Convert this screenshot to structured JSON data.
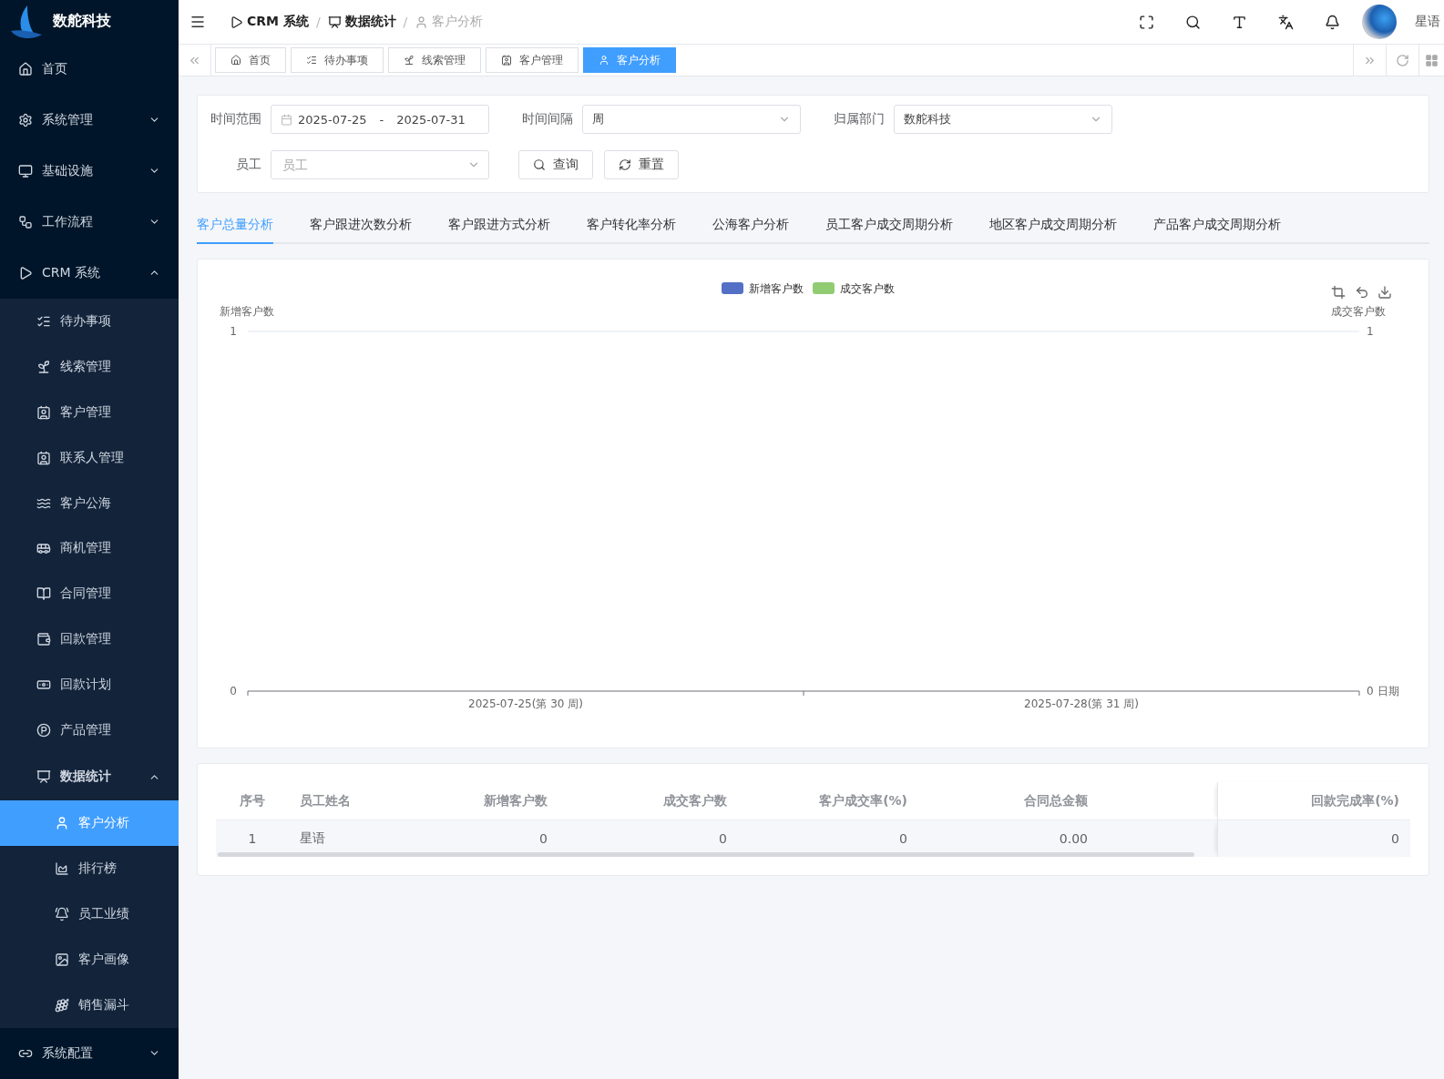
{
  "brand": {
    "name": "数舵科技"
  },
  "sidebar": {
    "items": [
      {
        "label": "首页",
        "selected": false
      },
      {
        "label": "系统管理",
        "expanded": false,
        "selected": false
      },
      {
        "label": "基础设施",
        "expanded": false,
        "selected": false
      },
      {
        "label": "工作流程",
        "expanded": false,
        "selected": false
      },
      {
        "label": "CRM 系统",
        "expanded": true,
        "selected": false,
        "children": [
          {
            "label": "待办事项",
            "selected": false
          },
          {
            "label": "线索管理",
            "selected": false
          },
          {
            "label": "客户管理",
            "selected": false
          },
          {
            "label": "联系人管理",
            "selected": false
          },
          {
            "label": "客户公海",
            "selected": false
          },
          {
            "label": "商机管理",
            "selected": false
          },
          {
            "label": "合同管理",
            "selected": false
          },
          {
            "label": "回款管理",
            "selected": false
          },
          {
            "label": "回款计划",
            "selected": false
          },
          {
            "label": "产品管理",
            "selected": false
          },
          {
            "label": "数据统计",
            "expanded": true,
            "selected": false,
            "children": [
              {
                "label": "客户分析",
                "selected": true
              },
              {
                "label": "排行榜",
                "selected": false
              },
              {
                "label": "员工业绩",
                "selected": false
              },
              {
                "label": "客户画像",
                "selected": false
              },
              {
                "label": "销售漏斗",
                "selected": false
              }
            ]
          }
        ]
      },
      {
        "label": "系统配置",
        "expanded": false,
        "selected": false
      }
    ]
  },
  "header": {
    "breadcrumb": [
      {
        "label": "CRM 系统"
      },
      {
        "separator": "/",
        "label": "数据统计"
      },
      {
        "separator": "/",
        "label": "客户分析"
      }
    ],
    "user": {
      "name": "星语"
    }
  },
  "page_tabs": [
    {
      "label": "首页",
      "selected": false
    },
    {
      "label": "待办事项",
      "selected": false
    },
    {
      "label": "线索管理",
      "selected": false
    },
    {
      "label": "客户管理",
      "selected": false
    },
    {
      "label": "客户分析",
      "selected": true
    }
  ],
  "filters": {
    "time_range": {
      "label": "时间范围",
      "start": "2025-07-25",
      "separator": "-",
      "end": "2025-07-31"
    },
    "interval": {
      "label": "时间间隔",
      "value": "周"
    },
    "department": {
      "label": "归属部门",
      "value": "数舵科技"
    },
    "employee": {
      "label": "员工",
      "placeholder": "员工"
    },
    "buttons": [
      {
        "label": "查询",
        "kind": "search"
      },
      {
        "label": "重置",
        "kind": "reset"
      }
    ]
  },
  "analysis_tabs": [
    {
      "label": "客户总量分析",
      "selected": true
    },
    {
      "label": "客户跟进次数分析",
      "selected": false
    },
    {
      "label": "客户跟进方式分析",
      "selected": false
    },
    {
      "label": "客户转化率分析",
      "selected": false
    },
    {
      "label": "公海客户分析",
      "selected": false
    },
    {
      "label": "员工客户成交周期分析",
      "selected": false
    },
    {
      "label": "地区客户成交周期分析",
      "selected": false
    },
    {
      "label": "产品客户成交周期分析",
      "selected": false
    }
  ],
  "chart_data": {
    "type": "bar",
    "ylabel": "新增客户数",
    "xlabel": "日期",
    "categories": [
      "2025-07-25(第 30 周)",
      "2025-07-28(第 31 周)"
    ],
    "series": [
      {
        "name": "新增客户数",
        "color": "#5470c6",
        "values": [
          0,
          0
        ]
      },
      {
        "name": "成交客户数",
        "color": "#91cc75",
        "values": [
          0,
          0
        ]
      }
    ],
    "ylim": [
      0,
      1
    ],
    "yticks": [
      {
        "value": 0,
        "label": "0"
      },
      {
        "value": 1,
        "label": "1"
      }
    ]
  },
  "chart_right_axis": {
    "title": "成交客户数",
    "ticks": [
      "1",
      "0"
    ]
  },
  "table": {
    "columns": [
      "序号",
      "员工姓名",
      "新增客户数",
      "成交客户数",
      "客户成交率(%)",
      "合同总金额",
      "回款完成率(%)"
    ],
    "rows": [
      [
        "1",
        "星语",
        "0",
        "0",
        "0",
        "0.00",
        "0"
      ]
    ]
  }
}
